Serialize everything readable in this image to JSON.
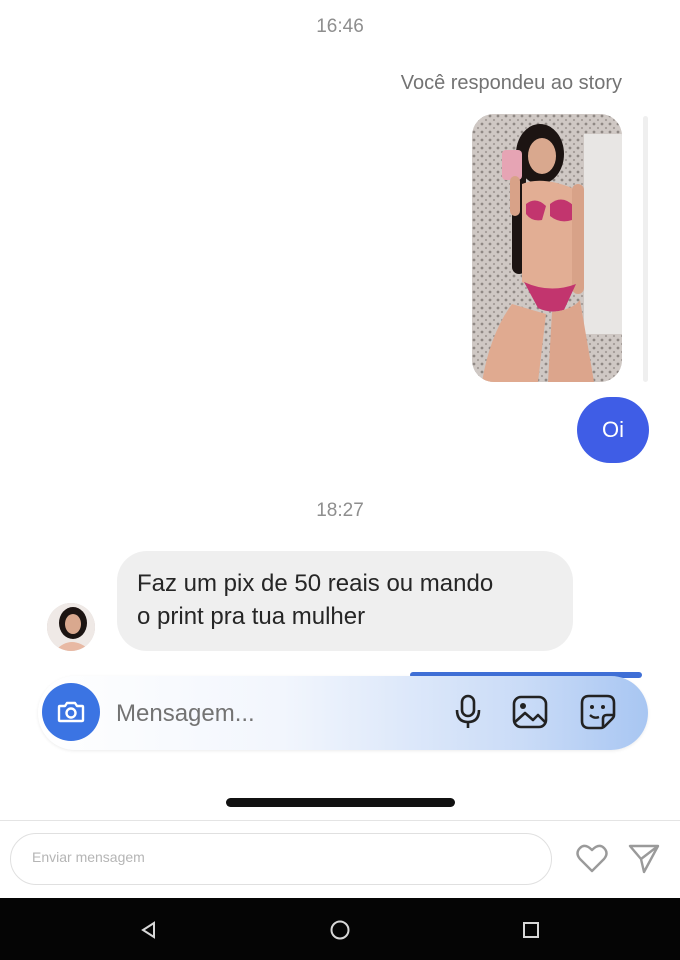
{
  "conversation": {
    "timestamp_1": "16:46",
    "reply_note": "Você respondeu ao story",
    "outgoing_message": "Oi",
    "timestamp_2": "18:27",
    "incoming_message_line1": "Faz um pix de 50 reais ou mando",
    "incoming_message_line2": "o print pra tua mulher"
  },
  "composer": {
    "placeholder": "Mensagem...",
    "icons": [
      "camera-icon",
      "microphone-icon",
      "gallery-icon",
      "sticker-icon"
    ]
  },
  "story_footer": {
    "send_placeholder": "Enviar mensagem",
    "icons": [
      "heart-icon",
      "send-icon"
    ]
  },
  "navigation": {
    "icons": [
      "back-icon",
      "home-icon",
      "recents-icon"
    ]
  },
  "colors": {
    "accent": "#3f5de6",
    "camera_button": "#3b74e3",
    "incoming_bubble": "#efefef"
  }
}
